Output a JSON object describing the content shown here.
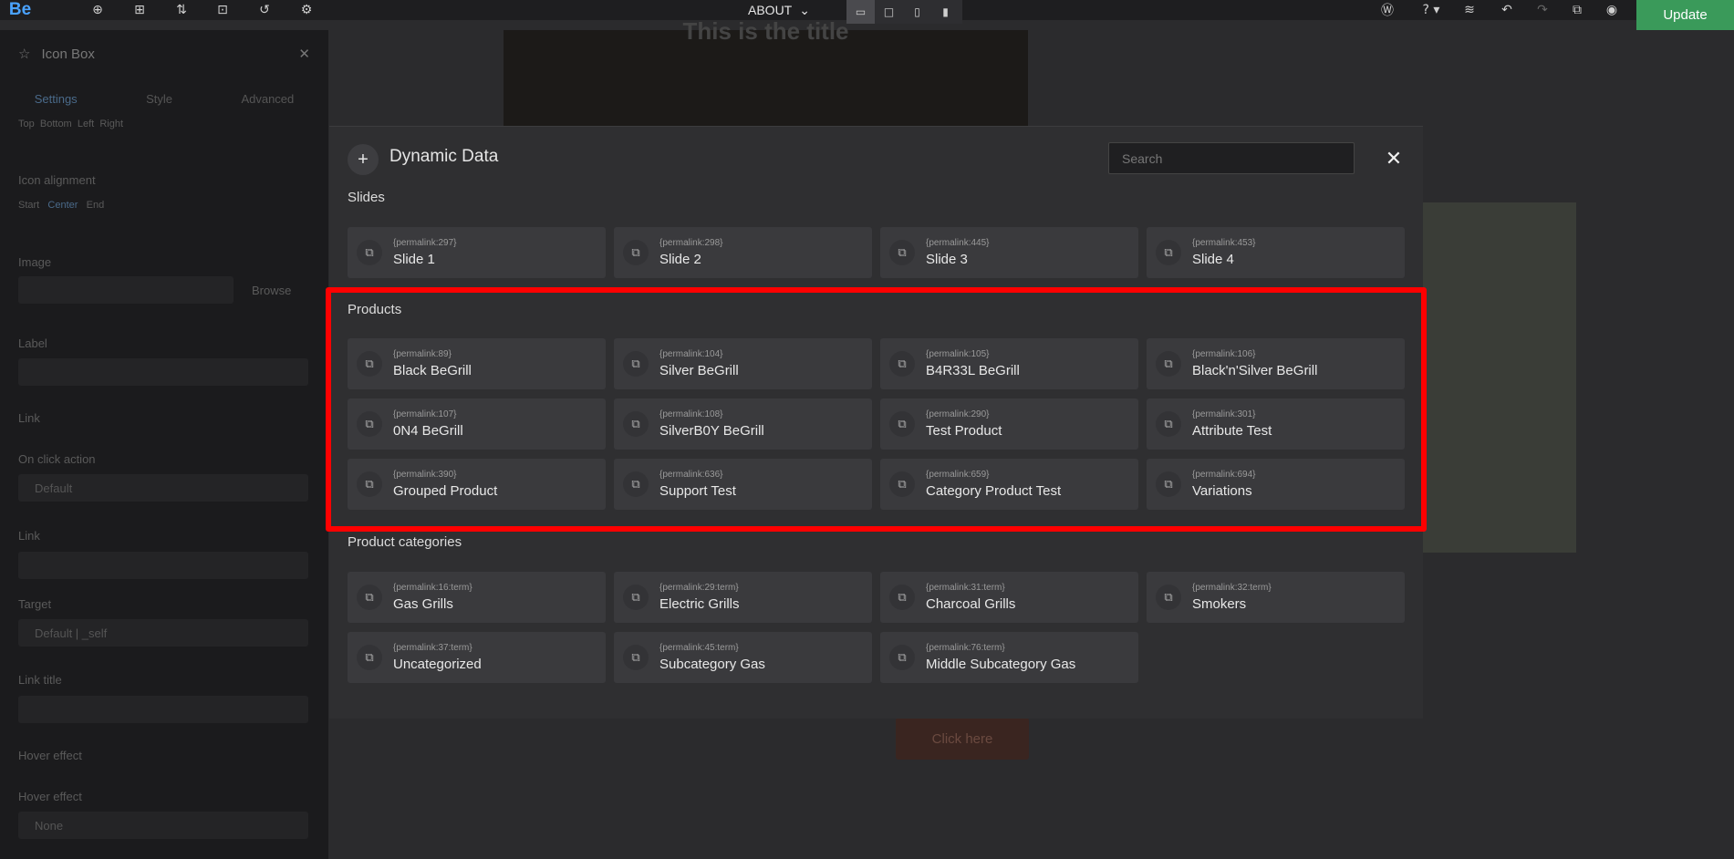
{
  "toolbar": {
    "logo": "Be",
    "page_selector": "ABOUT",
    "update_label": "Update",
    "icons": [
      "add-icon",
      "layout-icon",
      "sort-icon",
      "import-icon",
      "history-icon",
      "settings-icon"
    ],
    "right_icons": [
      "wordpress-icon",
      "help-icon",
      "layers-icon",
      "undo-icon",
      "redo-icon",
      "preview-icon",
      "view-icon"
    ]
  },
  "left_panel": {
    "title": "Icon Box",
    "tabs": [
      "Settings",
      "Style",
      "Advanced"
    ],
    "position_options": [
      "Top",
      "Bottom",
      "Left",
      "Right"
    ],
    "icon_alignment_label": "Icon alignment",
    "alignment_options": [
      "Start",
      "Center",
      "End"
    ],
    "image_label": "Image",
    "browse_label": "Browse",
    "label_label": "Label",
    "link_section": "Link",
    "on_click_label": "On click action",
    "on_click_value": "Default",
    "link_label": "Link",
    "target_label": "Target",
    "target_value": "Default | _self",
    "link_title_label": "Link title",
    "hover_section": "Hover effect",
    "hover_label": "Hover effect",
    "hover_value": "None"
  },
  "preview": {
    "heading": "This is the title",
    "button_label": "Click here"
  },
  "modal": {
    "title": "Dynamic Data",
    "search_placeholder": "Search",
    "sections": [
      {
        "title": "Slides",
        "items": [
          {
            "code": "{permalink:297}",
            "label": "Slide 1"
          },
          {
            "code": "{permalink:298}",
            "label": "Slide 2"
          },
          {
            "code": "{permalink:445}",
            "label": "Slide 3"
          },
          {
            "code": "{permalink:453}",
            "label": "Slide 4"
          }
        ]
      },
      {
        "title": "Products",
        "items": [
          {
            "code": "{permalink:89}",
            "label": "Black BeGrill"
          },
          {
            "code": "{permalink:104}",
            "label": "Silver BeGrill"
          },
          {
            "code": "{permalink:105}",
            "label": "B4R33L BeGrill"
          },
          {
            "code": "{permalink:106}",
            "label": "Black'n'Silver BeGrill"
          },
          {
            "code": "{permalink:107}",
            "label": "0N4 BeGrill"
          },
          {
            "code": "{permalink:108}",
            "label": "SilverB0Y BeGrill"
          },
          {
            "code": "{permalink:290}",
            "label": "Test Product"
          },
          {
            "code": "{permalink:301}",
            "label": "Attribute Test"
          },
          {
            "code": "{permalink:390}",
            "label": "Grouped Product"
          },
          {
            "code": "{permalink:636}",
            "label": "Support Test"
          },
          {
            "code": "{permalink:659}",
            "label": "Category Product Test"
          },
          {
            "code": "{permalink:694}",
            "label": "Variations"
          }
        ]
      },
      {
        "title": "Product categories",
        "items": [
          {
            "code": "{permalink:16:term}",
            "label": "Gas Grills"
          },
          {
            "code": "{permalink:29:term}",
            "label": "Electric Grills"
          },
          {
            "code": "{permalink:31:term}",
            "label": "Charcoal Grills"
          },
          {
            "code": "{permalink:32:term}",
            "label": "Smokers"
          },
          {
            "code": "{permalink:37:term}",
            "label": "Uncategorized"
          },
          {
            "code": "{permalink:45:term}",
            "label": "Subcategory Gas"
          },
          {
            "code": "{permalink:76:term}",
            "label": "Middle Subcategory Gas"
          }
        ]
      }
    ]
  },
  "colors": {
    "highlight": "#ff0000",
    "update_button": "#3a9a5a",
    "logo": "#4aa3ff"
  }
}
